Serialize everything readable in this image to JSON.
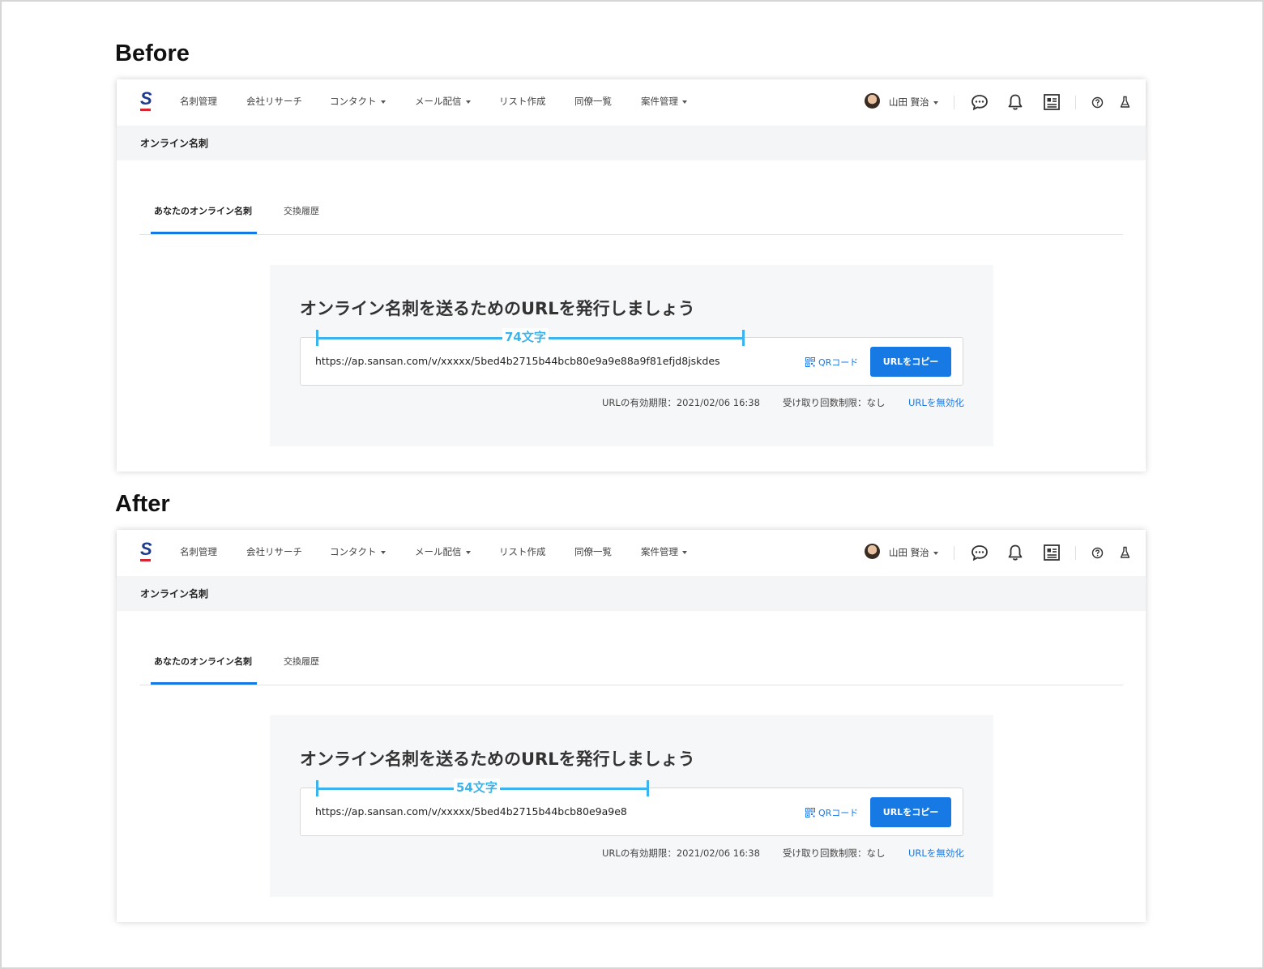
{
  "sections": {
    "before": "Before",
    "after": "After"
  },
  "app": {
    "logo_letter": "S",
    "nav": [
      "名刺管理",
      "会社リサーチ",
      "コンタクト",
      "メール配信",
      "リスト作成",
      "同僚一覧",
      "案件管理"
    ],
    "user_name": "山田 賢治",
    "subbar_title": "オンライン名刺",
    "tabs": [
      "あなたのオンライン名刺",
      "交換履歴"
    ],
    "heading": "オンライン名刺を送るためのURLを発行しましょう",
    "qr_label": "QRコード",
    "copy_button": "URLをコピー",
    "expiry": "URLの有効期限：2021/02/06 16:38",
    "receive_limit": "受け取り回数制限：なし",
    "invalidate_link": "URLを無効化"
  },
  "before": {
    "url": "https://ap.sansan.com/v/xxxxx/5bed4b2715b44bcb80e9a9e88a9f81efjd8jskdes",
    "measure_label": "74文字"
  },
  "after": {
    "url": "https://ap.sansan.com/v/xxxxx/5bed4b2715b44bcb80e9a9e8",
    "measure_label": "54文字"
  },
  "colors": {
    "accent_blue": "#1779e4",
    "annotation_blue": "#3bb3ec",
    "logo_blue": "#1d3b8c",
    "logo_red": "#d9232e"
  },
  "icons": [
    "chat-icon",
    "bell-icon",
    "card-list-icon",
    "help-icon",
    "flask-icon",
    "qr-code-icon",
    "user-avatar"
  ]
}
